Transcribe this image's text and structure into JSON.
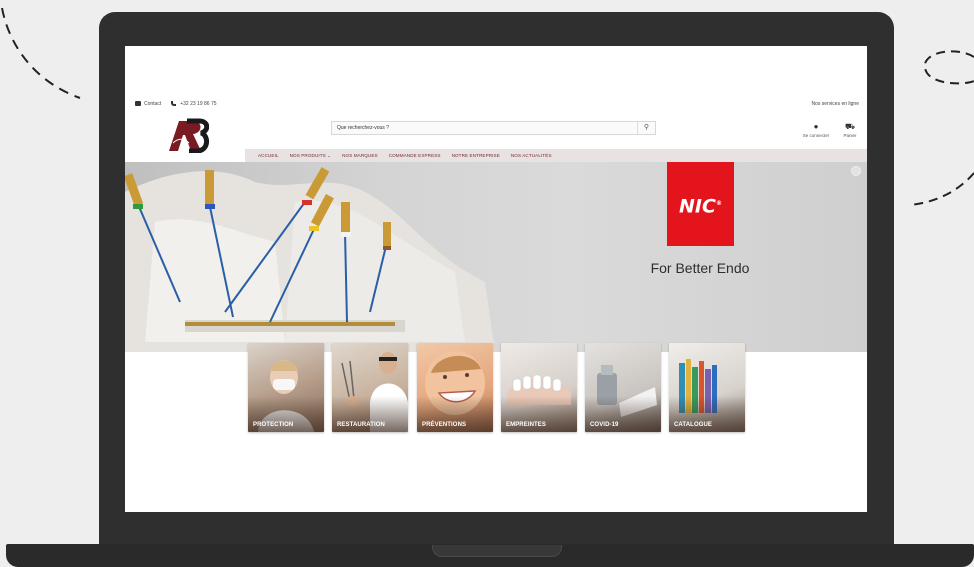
{
  "topbar": {
    "contact": "Contact",
    "phone": "+32 23 19 86 75",
    "services": "Nos services en ligne"
  },
  "search": {
    "placeholder": "Que recherchez-vous ?"
  },
  "account": {
    "label": "Se connecter"
  },
  "cart": {
    "label": "Panier"
  },
  "nav": {
    "items": [
      "ACCUEIL",
      "NOS PRODUITS ⌄",
      "NOS MARQUES",
      "COMMANDE EXPRESS",
      "NOTRE ENTREPRISE",
      "NOS ACTUALITÉS"
    ]
  },
  "hero": {
    "brand": "NIC",
    "tagline": "For Better Endo"
  },
  "categories": [
    "PROTECTION",
    "RESTAURATION",
    "PRÉVENTIONS",
    "EMPREINTES",
    "COVID-19",
    "CATALOGUE"
  ],
  "colors": {
    "nav_bg": "#e9e2e3",
    "nav_text": "#6b2b33",
    "brand_red": "#e3141b",
    "laptop": "#2f2f2f"
  }
}
